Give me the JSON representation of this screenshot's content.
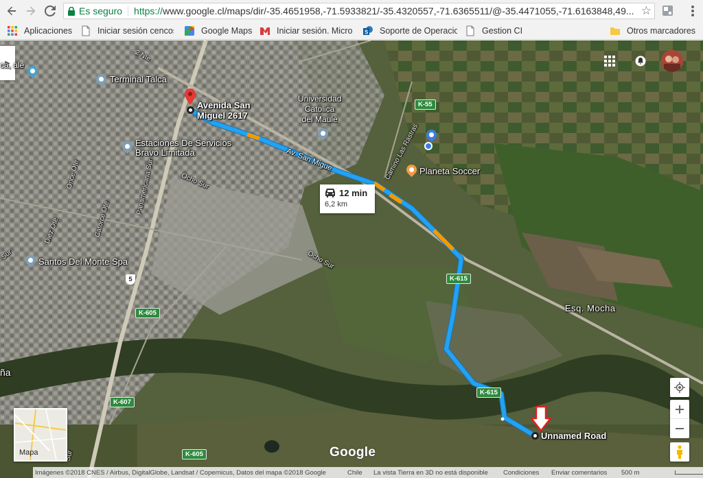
{
  "browser": {
    "secure_label": "Es seguro",
    "url_scheme": "https://",
    "url_rest": "www.google.cl/maps/dir/-35.4651958,-71.5933821/-35.4320557,-71.6365511/@-35.4471055,-71.6163848,49..."
  },
  "bookmarks": [
    {
      "label": "Aplicaciones",
      "icon": "apps-grid-icon"
    },
    {
      "label": "Iniciar sesión cencos",
      "icon": "page-icon"
    },
    {
      "label": "Google Maps",
      "icon": "google-maps-icon"
    },
    {
      "label": "Iniciar sesión. Micros",
      "icon": "red-m-icon"
    },
    {
      "label": "Soporte de Operacio",
      "icon": "sharepoint-icon"
    },
    {
      "label": "Gestion CI",
      "icon": "page-icon"
    },
    {
      "label": "Otros marcadores",
      "icon": "folder-icon"
    }
  ],
  "map": {
    "places": {
      "terminal": "Terminal Talca",
      "universidad": "Universidad\nCatolica\ndel Maule",
      "origin": "Avenida San\nMiguel 2617",
      "estaciones": "Estaciones De Servicios\nBravo Limitada",
      "planeta": "Planeta Soccer",
      "santos": "Santos Del Monte Spa",
      "esq_mocha": "Esq. Mocha",
      "destination": "Unnamed Road",
      "edge_top_left": "ca,\nale",
      "edge_left": "ña"
    },
    "streets": {
      "av_san_miguel": "Av. San Migue",
      "camino_las_rastras": "Camino Las Rastras",
      "panamericana_sur": "Panamericana Sur",
      "ocho_sur_1": "Ocho Sur",
      "ocho_sur_2": "Ocho Sur",
      "once_ote": "Once Ote",
      "catorce_ote": "Catorce Ote",
      "diez_ote": "Diez Ote",
      "dos_nte": "2 Nte",
      "sur_edge": "Sur",
      "sur_bottom": "Sur"
    },
    "road_badges": {
      "k55": "K-55",
      "k615a": "K-615",
      "k615b": "K-615",
      "k605a": "K-605",
      "k605b": "K-605",
      "k607": "K-607",
      "hwy5": "5"
    },
    "route": {
      "time": "12 min",
      "distance": "6,2 km",
      "color": "#22a2f2",
      "traffic_color": "#f29a00"
    },
    "minimap_label": "Mapa",
    "logo": "Google"
  },
  "attribution": {
    "imagery": "Imágenes ©2018 CNES / Airbus, DigitalGlobe, Landsat / Copernicus, Datos del mapa ©2018 Google",
    "country": "Chile",
    "earth3d": "La vista Tierra en 3D no está disponible",
    "terms": "Condiciones",
    "feedback": "Enviar comentarios",
    "scale": "500 m"
  }
}
